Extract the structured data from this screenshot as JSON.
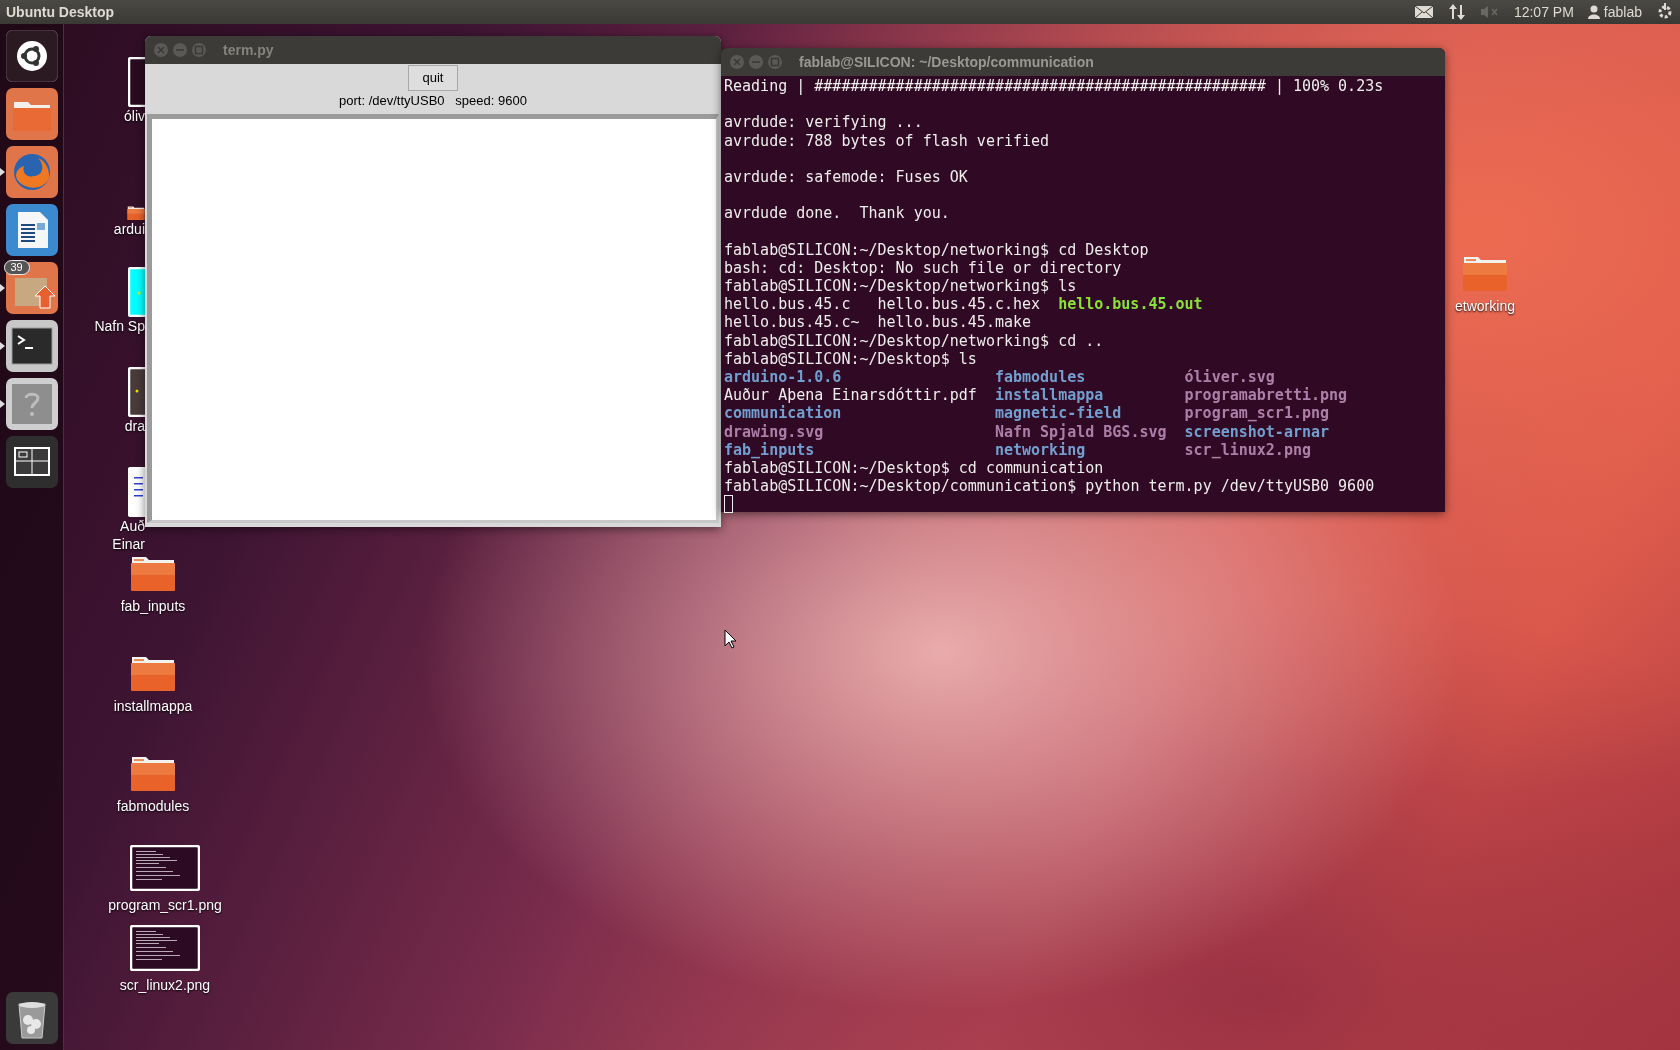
{
  "top_panel": {
    "title": "Ubuntu Desktop",
    "sound_muted": true,
    "clock": "12:07 PM",
    "user": "fablab"
  },
  "launcher": {
    "items": [
      {
        "kind": "dash",
        "running": false
      },
      {
        "kind": "files",
        "running": false
      },
      {
        "kind": "browser",
        "running": true
      },
      {
        "kind": "writer",
        "running": false
      },
      {
        "kind": "updater",
        "running": true,
        "badge": "39"
      },
      {
        "kind": "terminal",
        "running": true
      },
      {
        "kind": "help",
        "running": true
      },
      {
        "kind": "workspaces",
        "running": false
      }
    ],
    "trash": {
      "kind": "trash"
    }
  },
  "covered_icons": [
    {
      "kind": "thumb-dark",
      "label_lines": [
        "óliv"
      ]
    },
    {
      "kind": "folder",
      "label_lines": [
        "ardui"
      ]
    },
    {
      "kind": "thumb-cyan",
      "label_lines": [
        "Nafn Sp"
      ]
    },
    {
      "kind": "thumb-drawing",
      "label_lines": [
        "dra"
      ]
    },
    {
      "kind": "thumb-doc",
      "label_lines": [
        "Auð",
        "Einar"
      ]
    }
  ],
  "desktop_icons": [
    {
      "kind": "folder",
      "label": "fab_inputs"
    },
    {
      "kind": "folder",
      "label": "installmappa"
    },
    {
      "kind": "folder",
      "label": "fabmodules"
    },
    {
      "kind": "screenshot",
      "label": "program_scr1.png"
    },
    {
      "kind": "screenshot",
      "label": "scr_linux2.png"
    },
    {
      "kind": "folder",
      "label": "etworking"
    }
  ],
  "term_py_window": {
    "title": "term.py",
    "quit_button": "quit",
    "status": "port: /dev/ttyUSB0   speed: 9600"
  },
  "terminal_window": {
    "title": "fablab@SILICON: ~/Desktop/communication",
    "lines": [
      {
        "kind": "text",
        "text": "Reading | ################################################## | 100% 0.23s"
      },
      {
        "kind": "blank"
      },
      {
        "kind": "text",
        "text": "avrdude: verifying ..."
      },
      {
        "kind": "text",
        "text": "avrdude: 788 bytes of flash verified"
      },
      {
        "kind": "blank"
      },
      {
        "kind": "text",
        "text": "avrdude: safemode: Fuses OK"
      },
      {
        "kind": "blank"
      },
      {
        "kind": "text",
        "text": "avrdude done.  Thank you."
      },
      {
        "kind": "blank"
      },
      {
        "kind": "text",
        "text": "fablab@SILICON:~/Desktop/networking$ cd Desktop"
      },
      {
        "kind": "text",
        "text": "bash: cd: Desktop: No such file or directory"
      },
      {
        "kind": "text",
        "text": "fablab@SILICON:~/Desktop/networking$ ls"
      },
      {
        "kind": "listing",
        "rows": [
          [
            {
              "text": "hello.bus.45.c",
              "kind": "plain"
            },
            {
              "text": "hello.bus.45.c.hex",
              "kind": "plain"
            },
            {
              "text": "hello.bus.45.out",
              "kind": "executable"
            }
          ],
          [
            {
              "text": "hello.bus.45.c~",
              "kind": "plain"
            },
            {
              "text": "hello.bus.45.make",
              "kind": "plain"
            }
          ]
        ]
      },
      {
        "kind": "text",
        "text": "fablab@SILICON:~/Desktop/networking$ cd .."
      },
      {
        "kind": "text",
        "text": "fablab@SILICON:~/Desktop$ ls"
      },
      {
        "kind": "listing",
        "rows": [
          [
            {
              "text": "arduino-1.0.6",
              "kind": "directory"
            },
            {
              "text": "fabmodules",
              "kind": "directory"
            },
            {
              "text": "óliver.svg",
              "kind": "image"
            }
          ],
          [
            {
              "text": "Auður Aþena Einarsdóttir.pdf",
              "kind": "plain"
            },
            {
              "text": "installmappa",
              "kind": "directory"
            },
            {
              "text": "programabretti.png",
              "kind": "image"
            }
          ],
          [
            {
              "text": "communication",
              "kind": "directory"
            },
            {
              "text": "magnetic-field",
              "kind": "directory"
            },
            {
              "text": "program_scr1.png",
              "kind": "image"
            }
          ],
          [
            {
              "text": "drawing.svg",
              "kind": "image"
            },
            {
              "text": "Nafn Spjald BGS.svg",
              "kind": "image"
            },
            {
              "text": "screenshot-arnar",
              "kind": "directory"
            }
          ],
          [
            {
              "text": "fab_inputs",
              "kind": "directory"
            },
            {
              "text": "networking",
              "kind": "directory"
            },
            {
              "text": "scr_linux2.png",
              "kind": "image"
            }
          ]
        ]
      },
      {
        "kind": "text",
        "text": "fablab@SILICON:~/Desktop$ cd communication"
      },
      {
        "kind": "text",
        "text": "fablab@SILICON:~/Desktop/communication$ python term.py /dev/ttyUSB0 9600"
      },
      {
        "kind": "cursor"
      }
    ]
  }
}
